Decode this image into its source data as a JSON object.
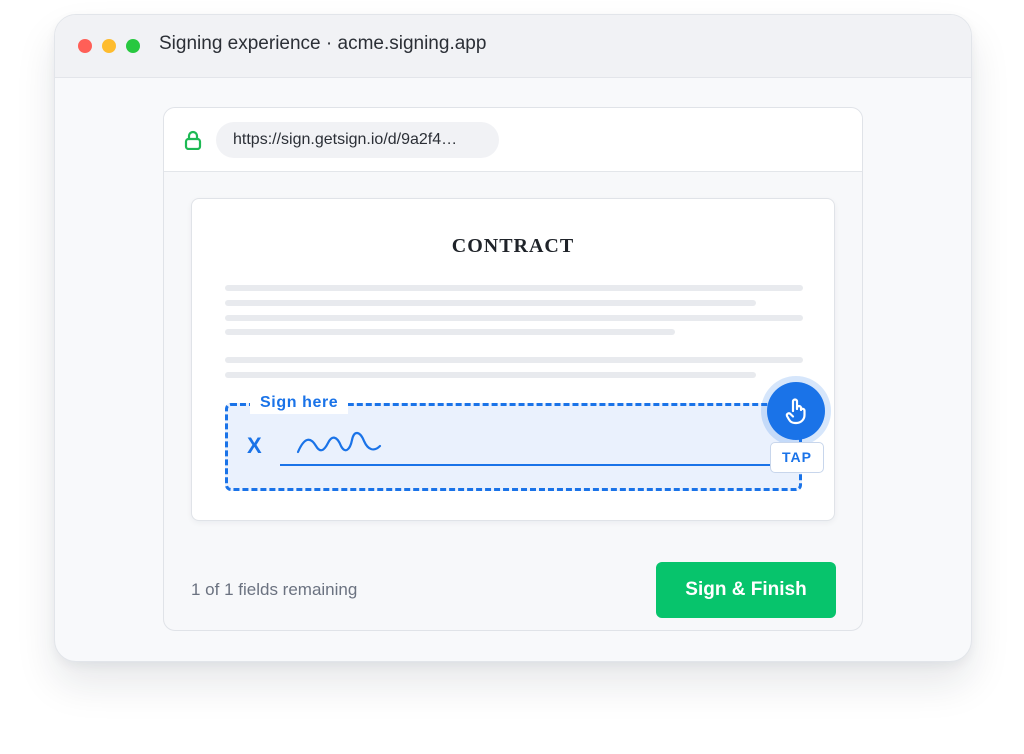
{
  "window": {
    "title": "Signing experience · acme.signing.app"
  },
  "browser": {
    "url": "https://sign.getsign.io/d/9a2f4…",
    "lock_icon": "lock-icon"
  },
  "document": {
    "title": "CONTRACT",
    "sign_field": {
      "label": "Sign here",
      "marker": "X",
      "tap_icon": "hand-pointer-icon",
      "tap_label": "TAP"
    }
  },
  "footer": {
    "remaining_text": "1 of 1 fields remaining",
    "finish_label": "Sign & Finish"
  },
  "colors": {
    "accent": "#1a73e8",
    "success": "#07c46c",
    "lock": "#1db954",
    "traffic_red": "#ff5f57",
    "traffic_yellow": "#febc2e",
    "traffic_green": "#28c840"
  }
}
